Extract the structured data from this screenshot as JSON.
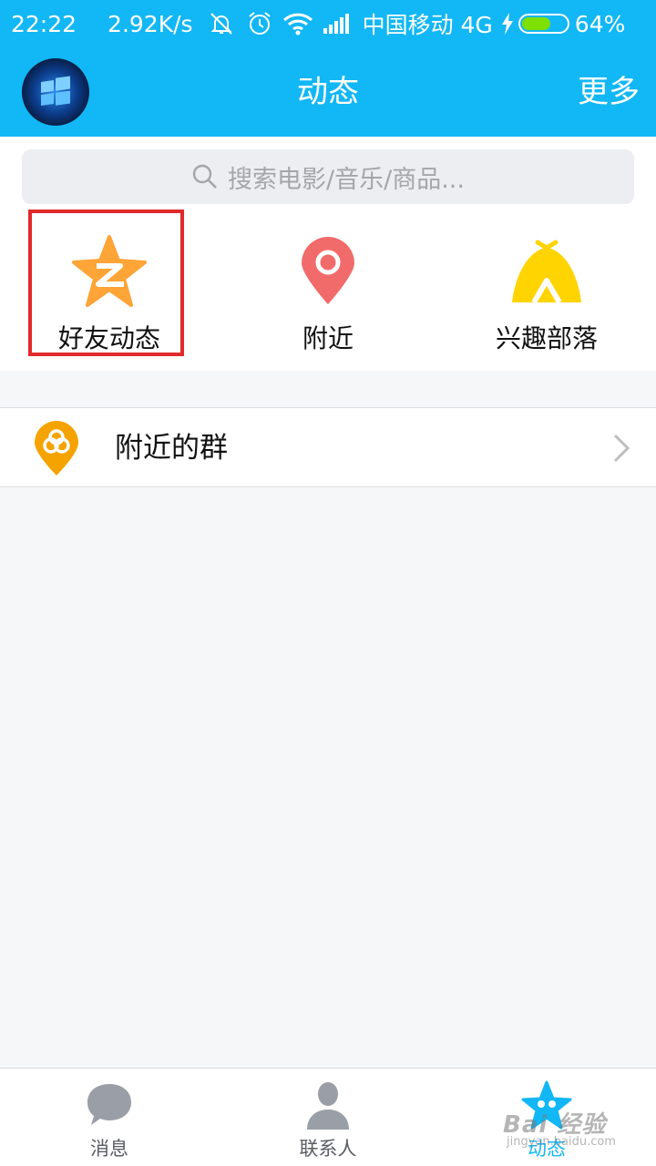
{
  "status_bar": {
    "time": "22:22",
    "speed": "2.92K/s",
    "carrier": "中国移动 4G",
    "battery": "64%",
    "battery_level": 0.64,
    "icons": [
      "mute-icon",
      "alarm-icon",
      "wifi-icon",
      "signal-icon",
      "charging-icon",
      "battery-icon"
    ]
  },
  "header": {
    "title": "动态",
    "more_label": "更多"
  },
  "search": {
    "placeholder": "搜索电影/音乐/商品..."
  },
  "features": [
    {
      "label": "好友动态",
      "icon": "qzone-star-icon",
      "highlighted": true
    },
    {
      "label": "附近",
      "icon": "location-pin-icon"
    },
    {
      "label": "兴趣部落",
      "icon": "tent-icon"
    }
  ],
  "list": [
    {
      "label": "附近的群",
      "icon": "nearby-group-icon"
    }
  ],
  "bottom_nav": [
    {
      "label": "消息",
      "icon": "message-bubble-icon"
    },
    {
      "label": "联系人",
      "icon": "contact-person-icon"
    },
    {
      "label": "动态",
      "icon": "star-icon",
      "active": true
    }
  ],
  "watermark": {
    "text": "Bai 经验",
    "sub": "jingyan.baidu.com"
  },
  "colors": {
    "brand": "#12b7f5",
    "highlight": "#e12a2a",
    "qzone": "#ffa436",
    "nearby": "#f26b6b",
    "tribe": "#ffd400",
    "group": "#f5a300"
  }
}
